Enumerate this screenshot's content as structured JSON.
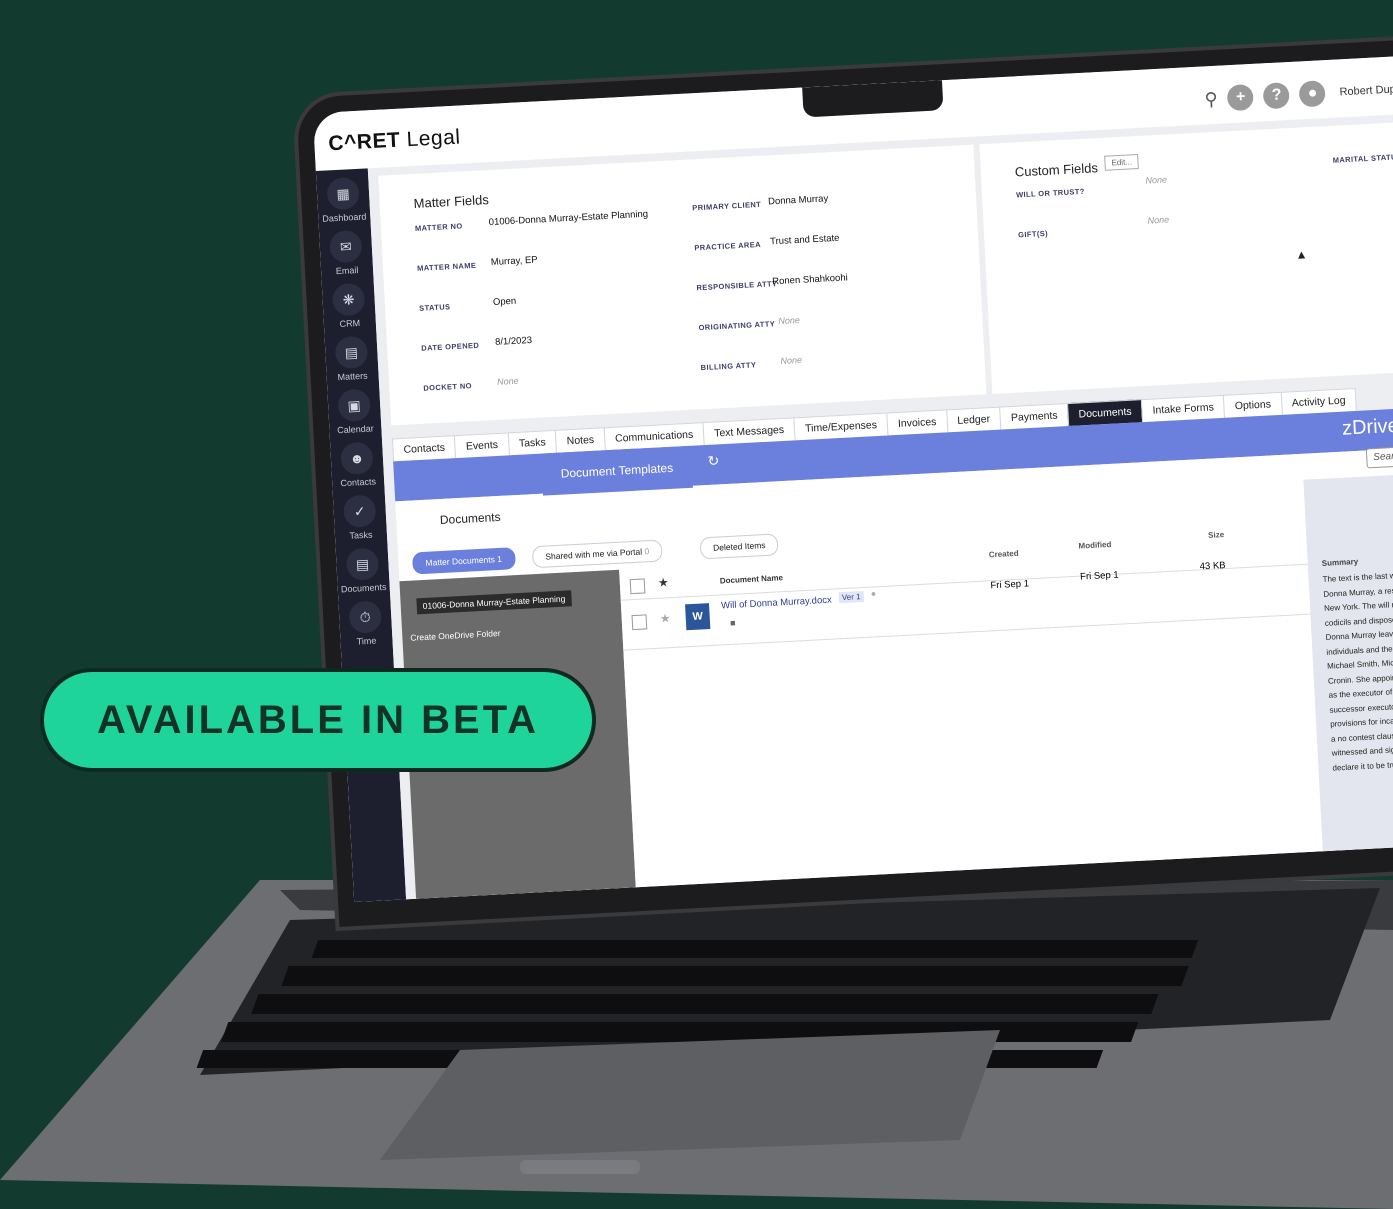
{
  "app": {
    "logo_bold": "C^RET",
    "logo_light": "Legal",
    "user_name": "Robert Dupont"
  },
  "sidebar": {
    "items": [
      {
        "label": "Dashboard",
        "icon": "dashboard-icon"
      },
      {
        "label": "Email",
        "icon": "email-icon"
      },
      {
        "label": "CRM",
        "icon": "crm-icon"
      },
      {
        "label": "Matters",
        "icon": "briefcase-icon"
      },
      {
        "label": "Calendar",
        "icon": "calendar-icon"
      },
      {
        "label": "Contacts",
        "icon": "contacts-icon"
      },
      {
        "label": "Tasks",
        "icon": "tasks-icon"
      },
      {
        "label": "Documents",
        "icon": "documents-icon"
      },
      {
        "label": "Time",
        "icon": "time-icon"
      }
    ]
  },
  "matter_fields": {
    "title": "Matter Fields",
    "matter_no_label": "MATTER NO",
    "matter_no": "01006-Donna Murray-Estate Planning",
    "matter_name_label": "MATTER NAME",
    "matter_name": "Murray, EP",
    "status_label": "STATUS",
    "status": "Open",
    "date_opened_label": "DATE OPENED",
    "date_opened": "8/1/2023",
    "docket_no_label": "DOCKET NO",
    "docket_no": "None",
    "primary_client_label": "PRIMARY CLIENT",
    "primary_client": "Donna Murray",
    "practice_area_label": "PRACTICE AREA",
    "practice_area": "Trust and Estate",
    "responsible_atty_label": "RESPONSIBLE ATTY",
    "responsible_atty": "Ronen Shahkoohi",
    "originating_atty_label": "ORIGINATING ATTY",
    "originating_atty": "None",
    "billing_atty_label": "BILLING ATTY",
    "billing_atty": "None"
  },
  "custom_fields": {
    "title": "Custom Fields",
    "edit_label": "Edit...",
    "will_label": "WILL OR TRUST?",
    "will_value": "None",
    "gifts_label": "GIFT(S)",
    "gifts_value": "None",
    "marital_label": "MARITAL STATU"
  },
  "tabs": [
    "Contacts",
    "Events",
    "Tasks",
    "Notes",
    "Communications",
    "Text Messages",
    "Time/Expenses",
    "Invoices",
    "Ledger",
    "Payments",
    "Documents",
    "Intake Forms",
    "Options",
    "Activity Log"
  ],
  "active_tab": "Documents",
  "zdrive": {
    "brand": "zDrive",
    "word_letter": "W",
    "doc_tab": "Documents",
    "templates_tab": "Document Templates",
    "search_placeholder": "Search",
    "pill_matter": "Matter Documents",
    "pill_matter_count": "1",
    "pill_shared": "Shared with me via Portal",
    "pill_shared_count": "0",
    "pill_deleted": "Deleted Items",
    "folder_name": "01006-Donna Murray-Estate Planning",
    "create_folder": "Create OneDrive Folder"
  },
  "table": {
    "col_name": "Document Name",
    "col_created": "Created",
    "col_modified": "Modified",
    "col_size": "Size",
    "rows": [
      {
        "name": "Will of Donna Murray.docx",
        "version": "Ver 1",
        "created": "Fri Sep 1",
        "modified": "Fri Sep 1",
        "size": "43 KB"
      }
    ]
  },
  "summary": {
    "title": "Summary",
    "lines": [
      "The text is the last will and testar",
      "Donna Murray, a resident of Nass",
      "New York. The will revokes all pri",
      "codicils and disposes of all her p",
      "Donna Murray leaves specific gif",
      "individuals and the residue of he",
      "Michael Smith, Michelle Smith, a",
      "Cronin. She appoints her son, Mi",
      "as the executor of her will and p",
      "successor executors. The will in",
      "provisions for incapacitated ber",
      "a no contest clause. Finally, the",
      "witnessed and signed by two wi",
      "declare it to be true and correct"
    ]
  },
  "badge": {
    "text": "AVAILABLE IN BETA"
  },
  "colors": {
    "background": "#133a2e",
    "accent": "#6b7fdc",
    "badge": "#1fd49a",
    "sidebar": "#1d1f2e"
  }
}
